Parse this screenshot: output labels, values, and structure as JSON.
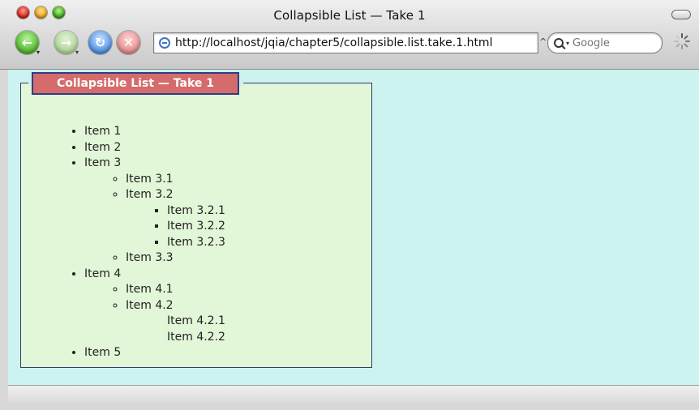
{
  "window": {
    "title": "Collapsible List — Take 1"
  },
  "toolbar": {
    "back_icon": "back-arrow-icon",
    "forward_icon": "forward-arrow-icon",
    "reload_icon": "reload-icon",
    "stop_icon": "stop-icon",
    "url": "http://localhost/jqia/chapter5/collapsible.list.take.1.html",
    "search_placeholder": "Google"
  },
  "page": {
    "legend": "Collapsible List — Take 1",
    "items": [
      {
        "label": "Item 1"
      },
      {
        "label": "Item 2"
      },
      {
        "label": "Item 3",
        "children": [
          {
            "label": "Item 3.1"
          },
          {
            "label": "Item 3.2",
            "children": [
              {
                "label": "Item 3.2.1"
              },
              {
                "label": "Item 3.2.2"
              },
              {
                "label": "Item 3.2.3"
              }
            ]
          },
          {
            "label": "Item 3.3"
          }
        ]
      },
      {
        "label": "Item 4",
        "children": [
          {
            "label": "Item 4.1"
          },
          {
            "label": "Item 4.2",
            "children": [
              {
                "label": "Item 4.2.1"
              },
              {
                "label": "Item 4.2.2"
              }
            ]
          }
        ]
      },
      {
        "label": "Item 5"
      }
    ]
  },
  "colors": {
    "page_background": "#ccf3ef",
    "fieldset_background": "#e2f6d8",
    "legend_background": "#d66b6b",
    "legend_border": "#2d3e85"
  }
}
